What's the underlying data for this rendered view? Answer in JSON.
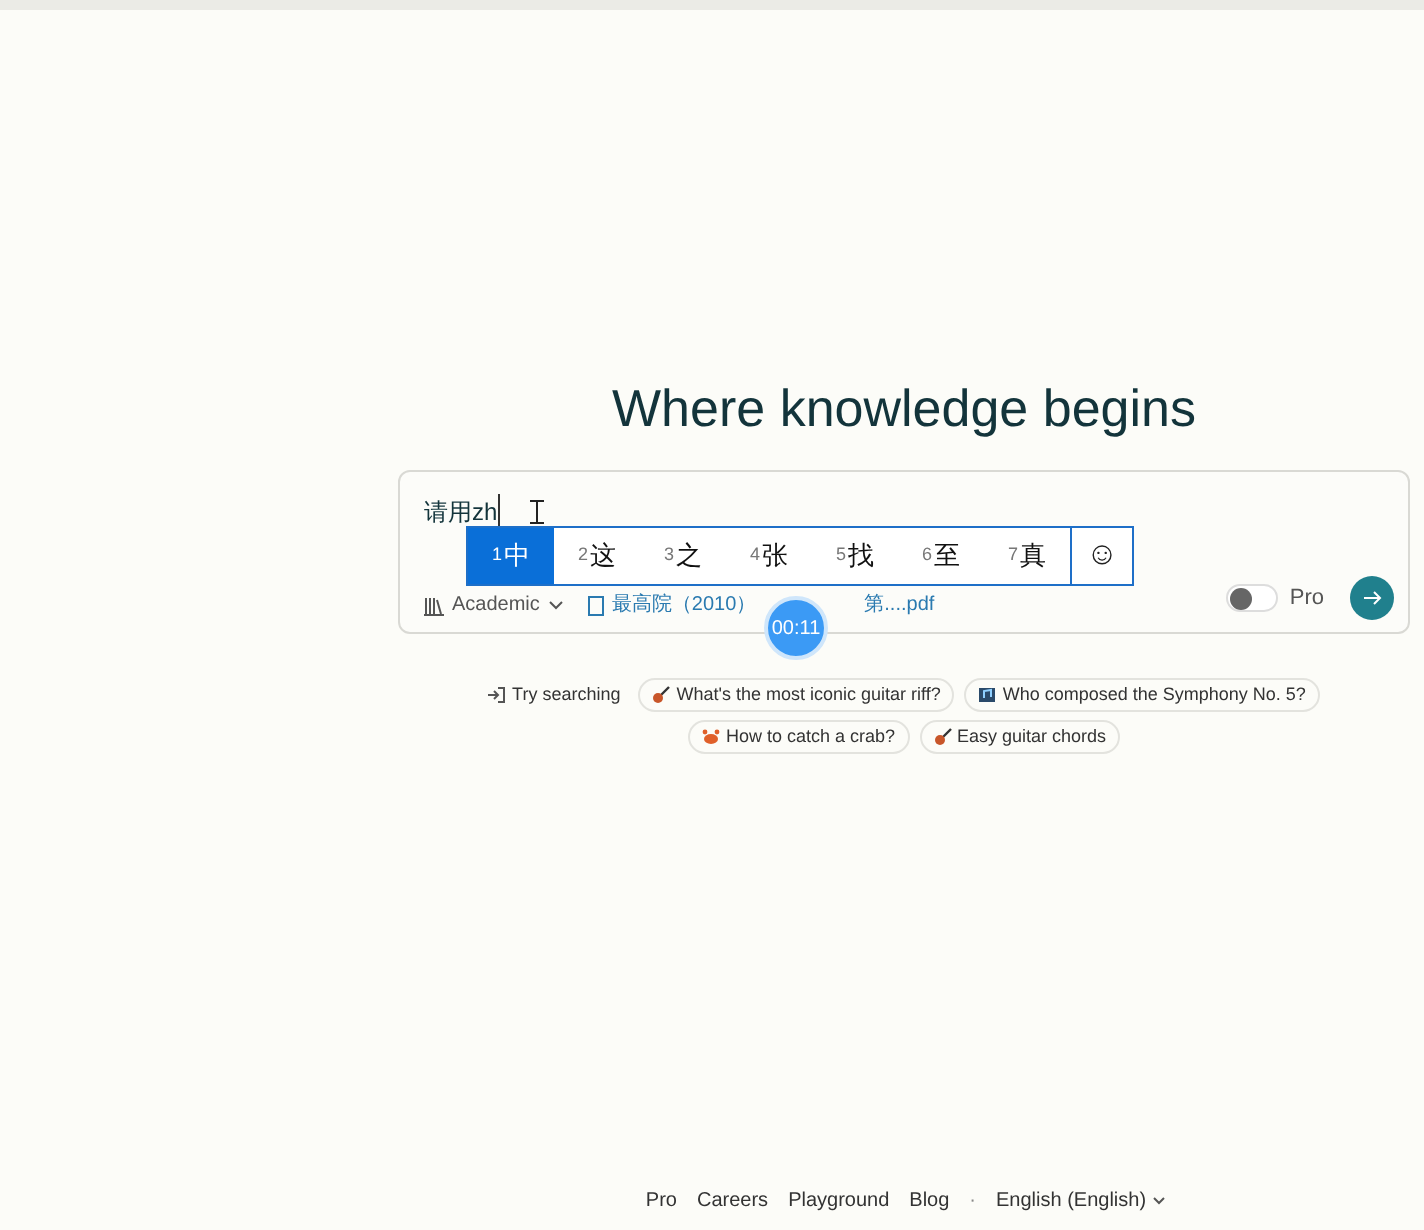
{
  "heading": "Where knowledge begins",
  "search": {
    "value": "请用zh",
    "focus": "Academic",
    "attachment_before": "最高院（2010）",
    "attachment_after": "第....pdf",
    "pro_toggle": {
      "label": "Pro",
      "on": false
    }
  },
  "ime": {
    "candidates": [
      {
        "index": "1",
        "text": "中",
        "selected": true
      },
      {
        "index": "2",
        "text": "这",
        "selected": false
      },
      {
        "index": "3",
        "text": "之",
        "selected": false
      },
      {
        "index": "4",
        "text": "张",
        "selected": false
      },
      {
        "index": "5",
        "text": "找",
        "selected": false
      },
      {
        "index": "6",
        "text": "至",
        "selected": false
      },
      {
        "index": "7",
        "text": "真",
        "selected": false
      }
    ],
    "emoji": "☺"
  },
  "timer": "00:11",
  "suggestions": {
    "label": "Try searching",
    "items": [
      {
        "text": "What's the most iconic guitar riff?",
        "kind": "guitar"
      },
      {
        "text": "Who composed the Symphony No. 5?",
        "kind": "music"
      },
      {
        "text": "How to catch a crab?",
        "kind": "crab"
      },
      {
        "text": "Easy guitar chords",
        "kind": "guitar"
      }
    ]
  },
  "footer": {
    "links": [
      "Pro",
      "Careers",
      "Playground",
      "Blog"
    ],
    "separator": "·",
    "language": "English (English)"
  }
}
